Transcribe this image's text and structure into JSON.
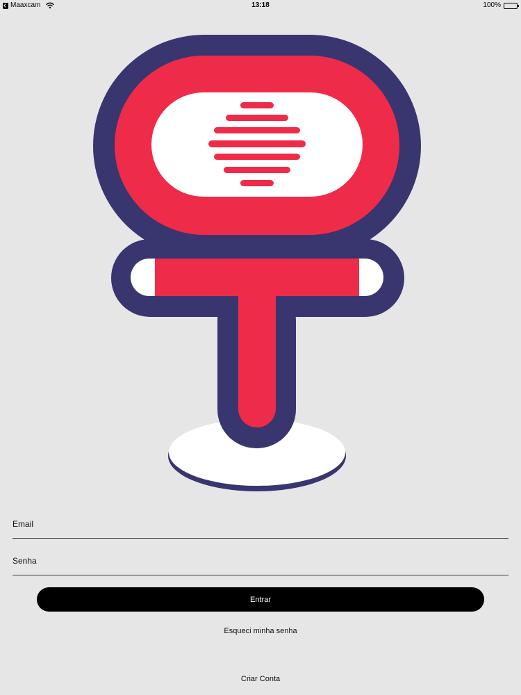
{
  "status_bar": {
    "back_app": "Maaxcam",
    "time": "13:18",
    "battery": "100%",
    "icons": [
      "back-app-icon",
      "wifi-icon",
      "battery-icon"
    ]
  },
  "logo": {
    "icon": "microphone-logo",
    "colors": {
      "navy": "#39356f",
      "red": "#ef2b4a",
      "white": "#ffffff"
    }
  },
  "form": {
    "email_placeholder": "Email",
    "password_placeholder": "Senha",
    "login_label": "Entrar",
    "forgot_password_label": "Esqueci minha senha",
    "create_account_label": "Criar Conta"
  },
  "colors": {
    "background": "#e6e6e7",
    "button": "#000000",
    "button_text": "#ffffff"
  }
}
